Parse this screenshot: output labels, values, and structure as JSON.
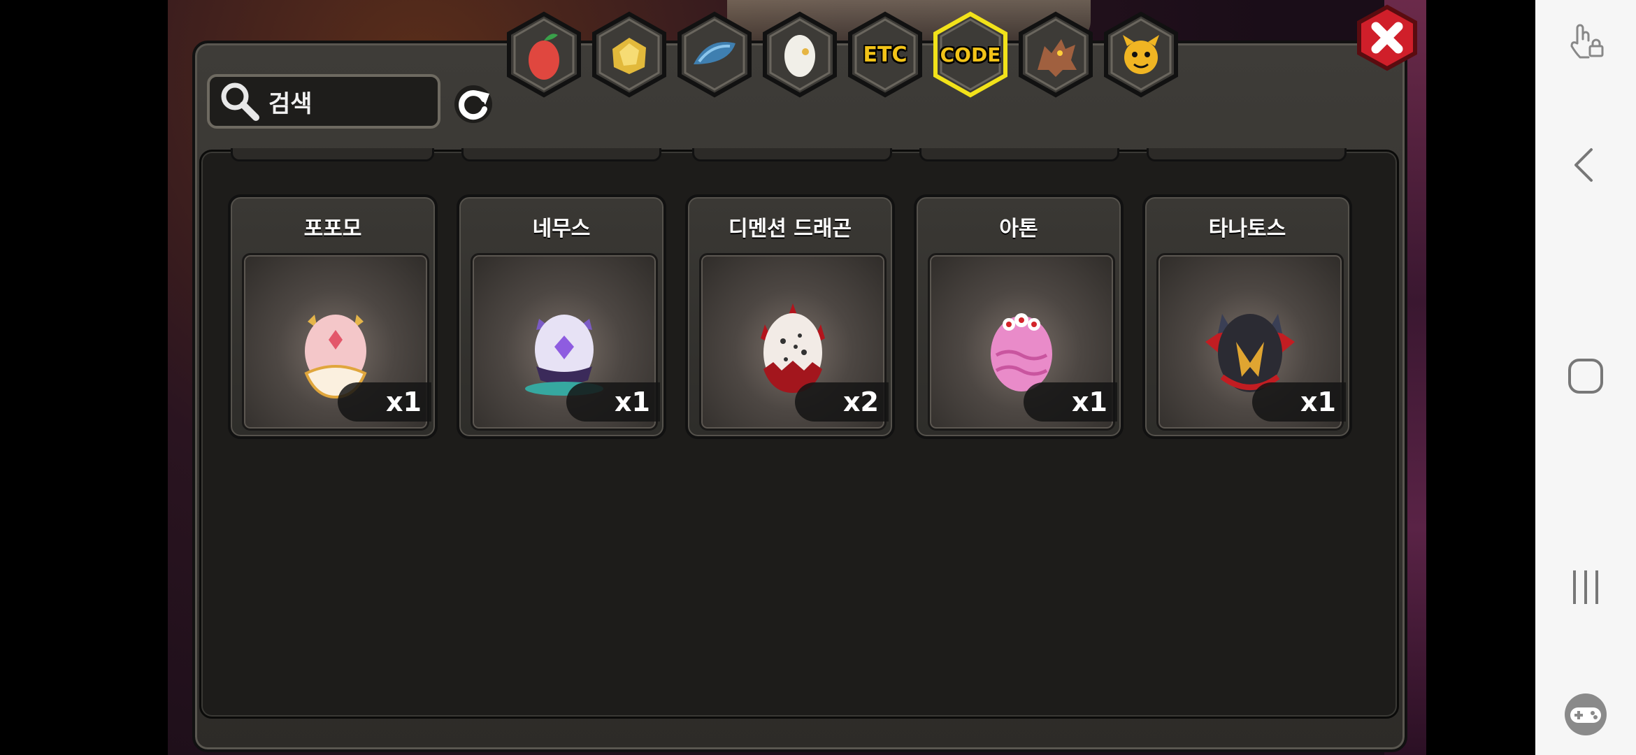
{
  "search": {
    "placeholder": "검색"
  },
  "tabs": [
    {
      "icon": "fruit-icon",
      "label": ""
    },
    {
      "icon": "gold-ore-icon",
      "label": ""
    },
    {
      "icon": "dragon-scale-icon",
      "label": ""
    },
    {
      "icon": "egg-icon",
      "label": ""
    },
    {
      "icon": "etc-icon",
      "label": "ETC"
    },
    {
      "icon": "code-icon",
      "label": "CODE",
      "active": true
    },
    {
      "icon": "dragon-head-icon",
      "label": ""
    },
    {
      "icon": "monster-face-icon",
      "label": ""
    }
  ],
  "items": [
    {
      "name": "포포모",
      "count": "x1",
      "egg_color": "#f4c7c9"
    },
    {
      "name": "네무스",
      "count": "x1",
      "egg_color": "#e7e2f5"
    },
    {
      "name": "디멘션 드래곤",
      "count": "x2",
      "egg_color": "#f2ebe6"
    },
    {
      "name": "아톤",
      "count": "x1",
      "egg_color": "#e98bc9"
    },
    {
      "name": "타나토스",
      "count": "x1",
      "egg_color": "#2b2b33"
    }
  ],
  "colors": {
    "accent_yellow": "#f2c318",
    "close_red": "#d01f2a",
    "panel": "#2d2b28"
  }
}
